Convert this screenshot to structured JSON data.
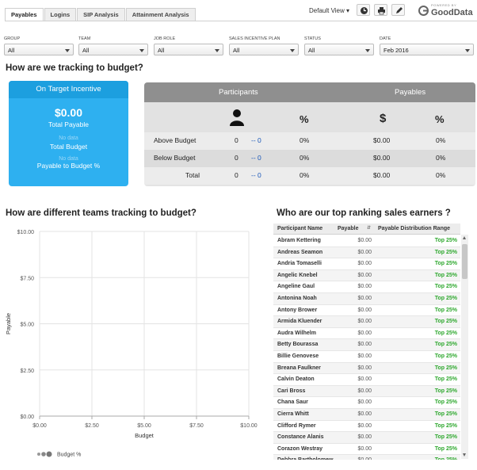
{
  "tabs": [
    "Payables",
    "Logins",
    "SIP Analysis",
    "Attainment Analysis"
  ],
  "toolbar": {
    "default_view": "Default View",
    "logo_powered": "POWERED BY",
    "logo_name": "GoodData"
  },
  "filters": [
    {
      "label": "GROUP",
      "value": "All"
    },
    {
      "label": "TEAM",
      "value": "All"
    },
    {
      "label": "JOB ROLE",
      "value": "All"
    },
    {
      "label": "SALES INCENTIVE PLAN",
      "value": "All"
    },
    {
      "label": "STATUS",
      "value": "All"
    },
    {
      "label": "DATE",
      "value": "Feb 2016"
    }
  ],
  "budget_section": {
    "title": "How are we tracking to budget?",
    "on_target": {
      "header": "On Target Incentive",
      "total_payable_value": "$0.00",
      "total_payable_label": "Total Payable",
      "no_data_1": "No data",
      "total_budget_label": "Total Budget",
      "no_data_2": "No data",
      "payable_pct_label": "Payable to Budget %"
    },
    "table": {
      "participants_header": "Participants",
      "payables_header": "Payables",
      "pct_symbol_1": "%",
      "dollar_symbol": "$",
      "pct_symbol_2": "%",
      "rows": [
        {
          "label": "Above Budget",
          "count": "0",
          "delta": "-- 0",
          "pct": "0%",
          "pay": "$0.00",
          "pay_pct": "0%"
        },
        {
          "label": "Below Budget",
          "count": "0",
          "delta": "-- 0",
          "pct": "0%",
          "pay": "$0.00",
          "pay_pct": "0%"
        },
        {
          "label": "Total",
          "count": "0",
          "delta": "-- 0",
          "pct": "0%",
          "pay": "$0.00",
          "pay_pct": "0%"
        }
      ]
    }
  },
  "teams_section": {
    "title": "How are different teams tracking to budget?"
  },
  "chart_data": {
    "type": "scatter",
    "title": "",
    "xlabel": "Budget",
    "ylabel": "Payable",
    "xlim": [
      0,
      10
    ],
    "ylim": [
      0,
      10
    ],
    "x_ticks": [
      "$0.00",
      "$2.50",
      "$5.00",
      "$7.50",
      "$10.00"
    ],
    "y_ticks": [
      "$0.00",
      "$2.50",
      "$5.00",
      "$7.50",
      "$10.00"
    ],
    "legend": [
      {
        "name": "Budget %"
      }
    ],
    "legend_position": "bottom-left",
    "grid": true,
    "series": []
  },
  "ranking_section": {
    "title": "Who are our top ranking sales earners ?",
    "columns": [
      "Participant Name",
      "Payable",
      "Payable Distribution Range"
    ],
    "rows": [
      {
        "name": "Abram Kettering",
        "payable": "$0.00",
        "range": "Top 25%"
      },
      {
        "name": "Andreas Seamon",
        "payable": "$0.00",
        "range": "Top 25%"
      },
      {
        "name": "Andria Tomaselli",
        "payable": "$0.00",
        "range": "Top 25%"
      },
      {
        "name": "Angelic Knebel",
        "payable": "$0.00",
        "range": "Top 25%"
      },
      {
        "name": "Angeline Gaul",
        "payable": "$0.00",
        "range": "Top 25%"
      },
      {
        "name": "Antonina Noah",
        "payable": "$0.00",
        "range": "Top 25%"
      },
      {
        "name": "Antony Brower",
        "payable": "$0.00",
        "range": "Top 25%"
      },
      {
        "name": "Armida Kluender",
        "payable": "$0.00",
        "range": "Top 25%"
      },
      {
        "name": "Audra Wilhelm",
        "payable": "$0.00",
        "range": "Top 25%"
      },
      {
        "name": "Betty Bourassa",
        "payable": "$0.00",
        "range": "Top 25%"
      },
      {
        "name": "Billie Genovese",
        "payable": "$0.00",
        "range": "Top 25%"
      },
      {
        "name": "Breana Faulkner",
        "payable": "$0.00",
        "range": "Top 25%"
      },
      {
        "name": "Calvin Deaton",
        "payable": "$0.00",
        "range": "Top 25%"
      },
      {
        "name": "Cari Bross",
        "payable": "$0.00",
        "range": "Top 25%"
      },
      {
        "name": "Chana Saur",
        "payable": "$0.00",
        "range": "Top 25%"
      },
      {
        "name": "Cierra Whitt",
        "payable": "$0.00",
        "range": "Top 25%"
      },
      {
        "name": "Clifford Rymer",
        "payable": "$0.00",
        "range": "Top 25%"
      },
      {
        "name": "Constance Alanis",
        "payable": "$0.00",
        "range": "Top 25%"
      },
      {
        "name": "Corazon Westray",
        "payable": "$0.00",
        "range": "Top 25%"
      },
      {
        "name": "Debbra Bartholomew",
        "payable": "$0.00",
        "range": "Top 25%"
      }
    ]
  }
}
